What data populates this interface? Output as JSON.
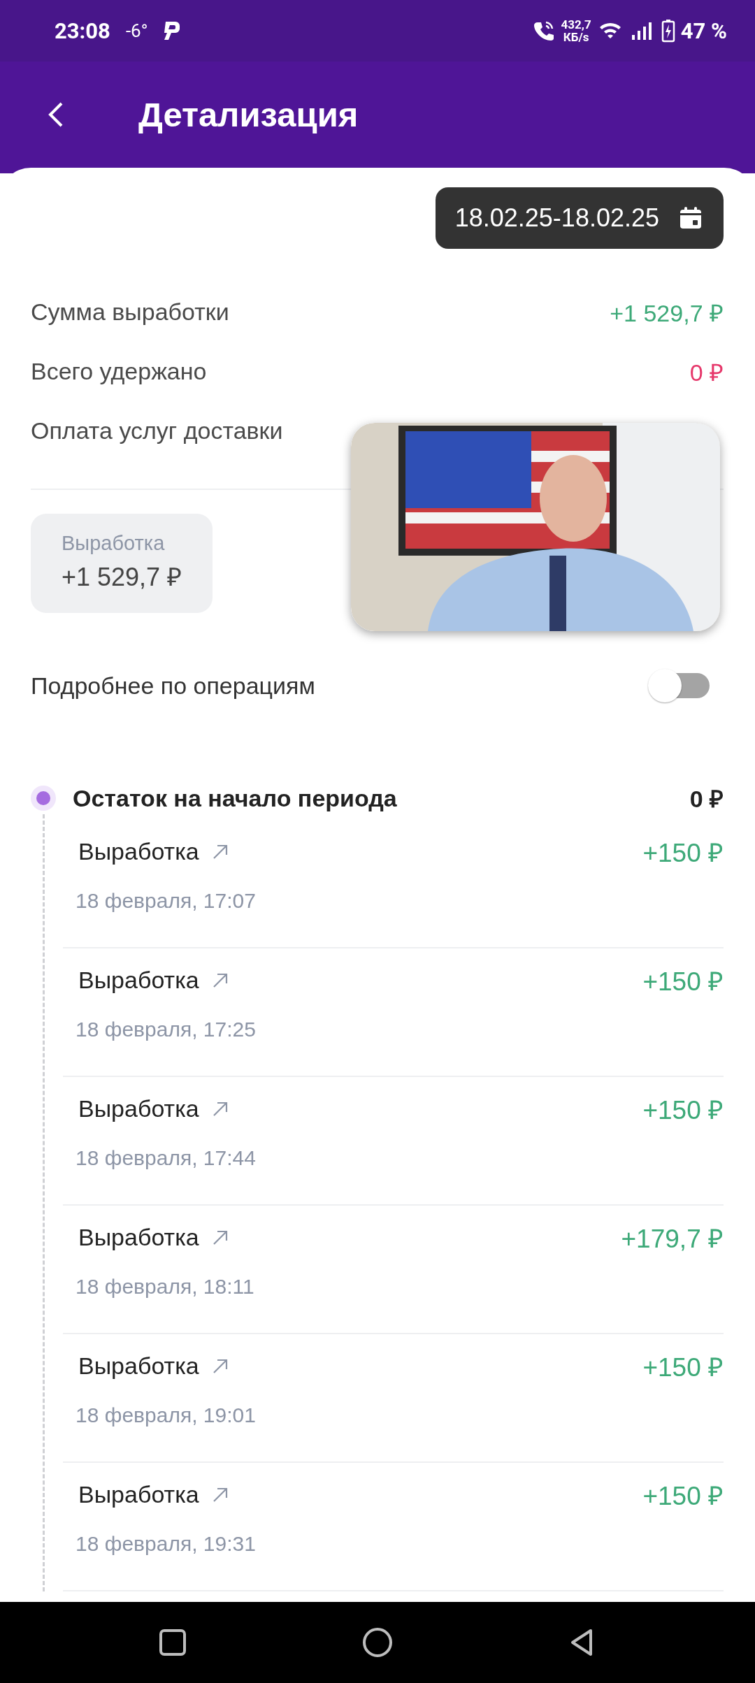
{
  "status_bar": {
    "time": "23:08",
    "temperature": "-6°",
    "network_speed": "432,7",
    "network_speed_unit": "КБ/s",
    "battery": "47 %"
  },
  "header": {
    "title": "Детализация"
  },
  "period": {
    "label": "18.02.25-18.02.25"
  },
  "summary": [
    {
      "label": "Сумма выработки",
      "value": "+1 529,7 ₽",
      "kind": "positive"
    },
    {
      "label": "Всего удержано",
      "value": "0 ₽",
      "kind": "negative"
    },
    {
      "label": "Оплата услуг доставки"
    }
  ],
  "earnings_chip": {
    "label": "Выработка",
    "value": "+1 529,7 ₽"
  },
  "details_toggle": {
    "label": "Подробнее по операциям",
    "on": false
  },
  "timeline": {
    "opening": {
      "label": "Остаток на начало периода",
      "value": "0 ₽"
    },
    "operations": [
      {
        "title": "Выработка",
        "date": "18 февраля, 17:07",
        "amount": "+150 ₽"
      },
      {
        "title": "Выработка",
        "date": "18 февраля, 17:25",
        "amount": "+150 ₽"
      },
      {
        "title": "Выработка",
        "date": "18 февраля, 17:44",
        "amount": "+150 ₽"
      },
      {
        "title": "Выработка",
        "date": "18 февраля, 18:11",
        "amount": "+179,7 ₽"
      },
      {
        "title": "Выработка",
        "date": "18 февраля, 19:01",
        "amount": "+150 ₽"
      },
      {
        "title": "Выработка",
        "date": "18 февраля, 19:31",
        "amount": "+150 ₽"
      }
    ]
  }
}
